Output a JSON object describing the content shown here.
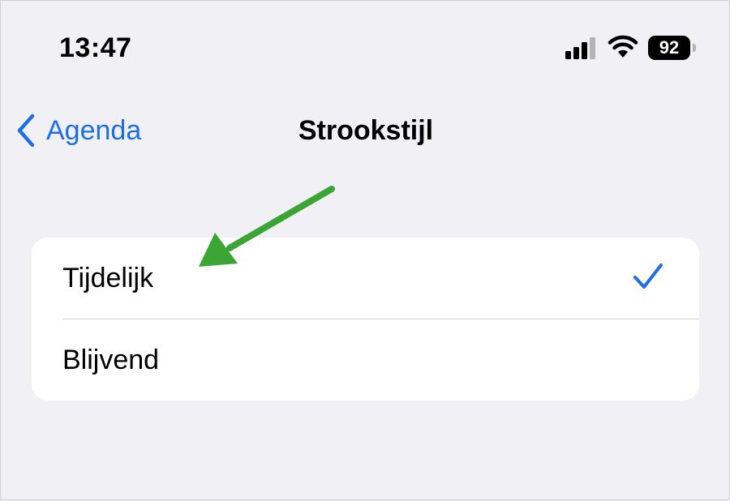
{
  "status_bar": {
    "time": "13:47",
    "battery_level": "92",
    "icons": [
      "signal-icon",
      "wifi-icon",
      "battery-icon"
    ]
  },
  "nav": {
    "back_label": "Agenda",
    "back_icon": "chevron-left-icon",
    "title": "Strookstijl"
  },
  "options": {
    "items": [
      {
        "label": "Tijdelijk",
        "selected": true
      },
      {
        "label": "Blijvend",
        "selected": false
      }
    ],
    "check_icon": "checkmark-icon"
  },
  "annotation": {
    "icon": "arrow-icon",
    "color": "#3aa535"
  },
  "colors": {
    "accent": "#1e6fe6",
    "background": "#f0f0f5",
    "card": "#ffffff"
  }
}
